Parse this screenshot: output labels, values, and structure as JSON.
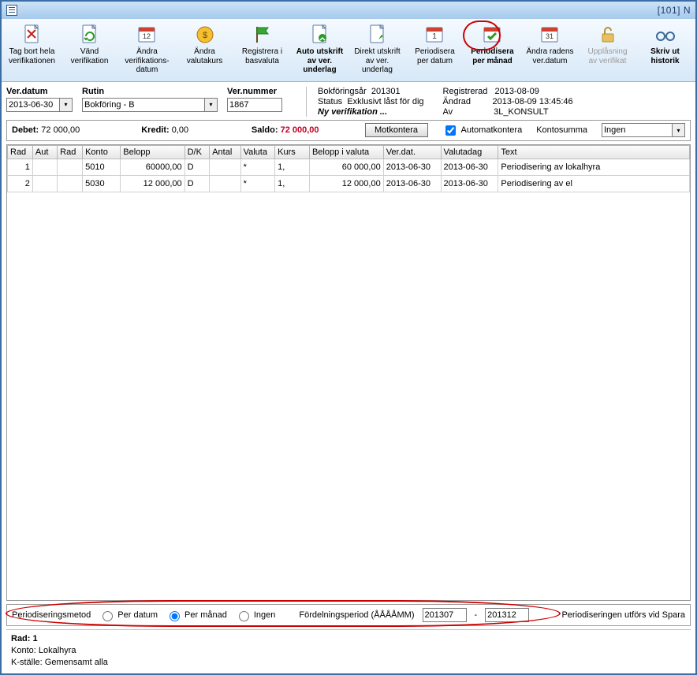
{
  "title": "[101]  N",
  "toolbar": [
    {
      "id": "delete",
      "label": "Tag bort hela\nverifikationen"
    },
    {
      "id": "reverse",
      "label": "Vänd\nverifikation"
    },
    {
      "id": "change-date",
      "label": "Ändra\nverifikations-\ndatum"
    },
    {
      "id": "change-rate",
      "label": "Ändra\nvalutakurs"
    },
    {
      "id": "register-base",
      "label": "Registrera i\nbasvaluta"
    },
    {
      "id": "auto-print",
      "label": "Auto utskrift\nav ver.\nunderlag",
      "bold": true
    },
    {
      "id": "direct-print",
      "label": "Direkt utskrift\nav ver.\nunderlag"
    },
    {
      "id": "period-date",
      "label": "Periodisera\nper datum"
    },
    {
      "id": "period-month",
      "label": "Periodisera\nper månad",
      "bold": true
    },
    {
      "id": "change-row-date",
      "label": "Ändra radens\nver.datum"
    },
    {
      "id": "unlock",
      "label": "Upplåsning\nav verifikat",
      "disabled": true
    },
    {
      "id": "print-history",
      "label": "Skriv ut\nhistorik",
      "bold": true
    }
  ],
  "fields": {
    "ver_datum_label": "Ver.datum",
    "ver_datum": "2013-06-30",
    "rutin_label": "Rutin",
    "rutin": "Bokföring - B",
    "ver_nummer_label": "Ver.nummer",
    "ver_nummer": "1867"
  },
  "meta": {
    "bokforingsar_k": "Bokföringsår",
    "bokforingsar_v": "201301",
    "registrerad_k": "Registrerad",
    "registrerad_v": "2013-08-09",
    "status_k": "Status",
    "status_v": "Exklusivt låst för dig",
    "andrad_k": "Ändrad",
    "andrad_v": "2013-08-09 13:45:46",
    "nyver": "Ny verifikation ...",
    "av_k": "Av",
    "av_v": "3L_KONSULT"
  },
  "sum": {
    "debet_l": "Debet:",
    "debet_v": "72 000,00",
    "kredit_l": "Kredit:",
    "kredit_v": "0,00",
    "saldo_l": "Saldo:",
    "saldo_v": "72 000,00",
    "motkontera": "Motkontera",
    "autokontera": "Automatkontera",
    "kontosumma_l": "Kontosumma",
    "kontosumma_v": "Ingen"
  },
  "columns": [
    "Rad",
    "Aut",
    "Rad",
    "Konto",
    "Belopp",
    "D/K",
    "Antal",
    "Valuta",
    "Kurs",
    "Belopp i valuta",
    "Ver.dat.",
    "Valutadag",
    "Text"
  ],
  "rows": [
    {
      "rad": "1",
      "aut": "",
      "rad2": "",
      "konto": "5010",
      "belopp": "60000,00",
      "dk": "D",
      "antal": "",
      "valuta": "*",
      "kurs": "1,",
      "biv": "60 000,00",
      "verdat": "2013-06-30",
      "valutadag": "2013-06-30",
      "text": "Periodisering av lokalhyra"
    },
    {
      "rad": "2",
      "aut": "",
      "rad2": "",
      "konto": "5030",
      "belopp": "12 000,00",
      "dk": "D",
      "antal": "",
      "valuta": "*",
      "kurs": "1,",
      "biv": "12 000,00",
      "verdat": "2013-06-30",
      "valutadag": "2013-06-30",
      "text": "Periodisering av el"
    }
  ],
  "period": {
    "metod_l": "Periodiseringsmetod",
    "per_datum": "Per datum",
    "per_manad": "Per månad",
    "ingen": "Ingen",
    "fordel_l": "Fördelningsperiod (ÅÅÅÅMM)",
    "from": "201307",
    "dash": "-",
    "to": "201312",
    "info": "Periodiseringen utförs vid Spara"
  },
  "footer": {
    "rad": "Rad: 1",
    "konto": "Konto: Lokalhyra",
    "kstalle": "K-ställe: Gemensamt alla"
  }
}
